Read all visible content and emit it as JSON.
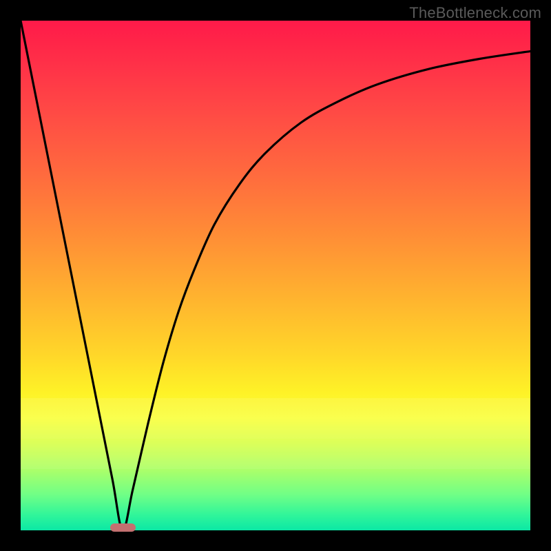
{
  "watermark": "TheBottleneck.com",
  "chart_data": {
    "type": "line",
    "title": "",
    "xlabel": "",
    "ylabel": "",
    "xlim": [
      0,
      100
    ],
    "ylim": [
      0,
      100
    ],
    "grid": false,
    "legend": false,
    "marker": {
      "x_percent_range": [
        17.5,
        22.5
      ],
      "y_percent": 0.5,
      "color": "#c37070"
    },
    "series": [
      {
        "name": "curve",
        "x": [
          0,
          5,
          10,
          15,
          18,
          20,
          22,
          25,
          28,
          31,
          34,
          38,
          43,
          48,
          55,
          62,
          70,
          80,
          90,
          100
        ],
        "y": [
          100,
          75,
          50,
          25,
          10,
          0,
          8,
          21,
          33,
          43,
          51,
          60,
          68,
          74,
          80,
          84,
          87.5,
          90.5,
          92.5,
          94
        ]
      }
    ]
  },
  "layout": {
    "image_size": 800,
    "plot_inset": 30,
    "plot_size": 740
  }
}
